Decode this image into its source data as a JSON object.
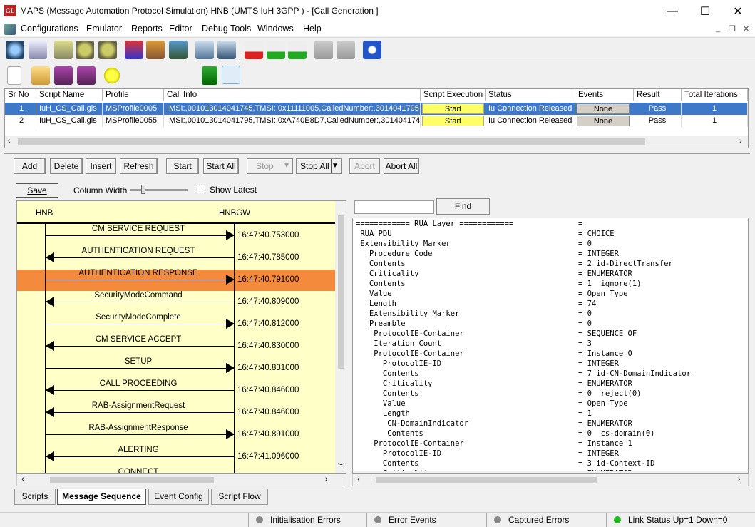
{
  "window": {
    "title": "MAPS (Message Automation Protocol Simulation) HNB (UMTS IuH 3GPP ) - [Call Generation ]",
    "minimize": "—",
    "maximize": "☐",
    "close": "✕"
  },
  "menu": [
    "Configurations",
    "Emulator",
    "Reports",
    "Editor",
    "Debug Tools",
    "Windows",
    "Help"
  ],
  "table": {
    "headers": [
      "Sr No",
      "Script Name",
      "Profile",
      "Call Info",
      "Script Execution",
      "Status",
      "Events",
      "Result",
      "Total Iterations"
    ],
    "rows": [
      {
        "sr": "1",
        "script": "IuH_CS_Call.gls",
        "profile": "MSProfile0005",
        "call_info": "IMSI:,001013014041745,TMSI:,0x11111005,CalledNumber:,3014041795",
        "exec": "Start",
        "status": "Iu Connection Released",
        "events": "None",
        "result": "Pass",
        "iterations": "1"
      },
      {
        "sr": "2",
        "script": "IuH_CS_Call.gls",
        "profile": "MSProfile0055",
        "call_info": "IMSI:,001013014041795,TMSI:,0xA740E8D7,CalledNumber:,3014041745",
        "exec": "Start",
        "status": "Iu Connection Released",
        "events": "None",
        "result": "Pass",
        "iterations": "1"
      }
    ]
  },
  "buttons": {
    "add": "Add",
    "delete": "Delete",
    "insert": "Insert",
    "refresh": "Refresh",
    "start": "Start",
    "start_all": "Start All",
    "stop": "Stop",
    "stop_all": "Stop All",
    "abort": "Abort",
    "abort_all": "Abort All",
    "save": "Save",
    "find": "Find"
  },
  "column_width_label": "Column Width",
  "show_latest_label": "Show Latest",
  "sequence": {
    "left_entity": "HNB",
    "right_entity": "HNBGW",
    "messages": [
      {
        "label": "CM SERVICE REQUEST",
        "dir": "right",
        "time": "16:47:40.753000"
      },
      {
        "label": "AUTHENTICATION REQUEST",
        "dir": "left",
        "time": "16:47:40.785000",
        "highlight": true
      },
      {
        "label": "AUTHENTICATION RESPONSE",
        "dir": "right",
        "time": "16:47:40.791000"
      },
      {
        "label": "SecurityModeCommand",
        "dir": "left",
        "time": "16:47:40.809000"
      },
      {
        "label": "SecurityModeComplete",
        "dir": "right",
        "time": "16:47:40.812000"
      },
      {
        "label": "CM SERVICE ACCEPT",
        "dir": "left",
        "time": "16:47:40.830000"
      },
      {
        "label": "SETUP",
        "dir": "right",
        "time": "16:47:40.831000"
      },
      {
        "label": "CALL PROCEEDING",
        "dir": "left",
        "time": "16:47:40.846000"
      },
      {
        "label": "RAB-AssignmentRequest",
        "dir": "left",
        "time": "16:47:40.846000"
      },
      {
        "label": "RAB-AssignmentResponse",
        "dir": "right",
        "time": "16:47:40.891000"
      },
      {
        "label": "ALERTING",
        "dir": "left",
        "time": "16:47:41.096000"
      },
      {
        "label": "CONNECT",
        "dir": "left",
        "time": ""
      }
    ]
  },
  "detail": [
    {
      "k": "============ RUA Layer ============",
      "v": "="
    },
    {
      "k": " RUA PDU",
      "v": "= CHOICE"
    },
    {
      "k": " Extensibility Marker",
      "v": "= 0"
    },
    {
      "k": "   Procedure Code",
      "v": "= INTEGER"
    },
    {
      "k": "   Contents",
      "v": "= 2 id-DirectTransfer"
    },
    {
      "k": "   Criticality",
      "v": "= ENUMERATOR"
    },
    {
      "k": "   Contents",
      "v": "= 1  ignore(1)"
    },
    {
      "k": "   Value",
      "v": "= Open Type"
    },
    {
      "k": "   Length",
      "v": "= 74"
    },
    {
      "k": "   Extensibility Marker",
      "v": "= 0"
    },
    {
      "k": "   Preamble",
      "v": "= 0"
    },
    {
      "k": "    ProtocolIE-Container",
      "v": "= SEQUENCE OF"
    },
    {
      "k": "    Iteration Count",
      "v": "= 3"
    },
    {
      "k": "    ProtocolIE-Container",
      "v": "= Instance 0"
    },
    {
      "k": "      ProtocolIE-ID",
      "v": "= INTEGER"
    },
    {
      "k": "      Contents",
      "v": "= 7 id-CN-DomainIndicator"
    },
    {
      "k": "      Criticality",
      "v": "= ENUMERATOR"
    },
    {
      "k": "      Contents",
      "v": "= 0  reject(0)"
    },
    {
      "k": "      Value",
      "v": "= Open Type"
    },
    {
      "k": "      Length",
      "v": "= 1"
    },
    {
      "k": "       CN-DomainIndicator",
      "v": "= ENUMERATOR"
    },
    {
      "k": "       Contents",
      "v": "= 0  cs-domain(0)"
    },
    {
      "k": "    ProtocolIE-Container",
      "v": "= Instance 1"
    },
    {
      "k": "      ProtocolIE-ID",
      "v": "= INTEGER"
    },
    {
      "k": "      Contents",
      "v": "= 3 id-Context-ID"
    },
    {
      "k": "      Criticality",
      "v": "= ENUMERATOR"
    }
  ],
  "tabs": [
    "Scripts",
    "Message Sequence",
    "Event Config",
    "Script Flow"
  ],
  "status": [
    {
      "label": "Initialisation Errors",
      "color": "#888888"
    },
    {
      "label": "Error Events",
      "color": "#888888"
    },
    {
      "label": "Captured Errors",
      "color": "#888888"
    },
    {
      "label": "Link Status Up=1 Down=0",
      "color": "#22bb22"
    }
  ]
}
